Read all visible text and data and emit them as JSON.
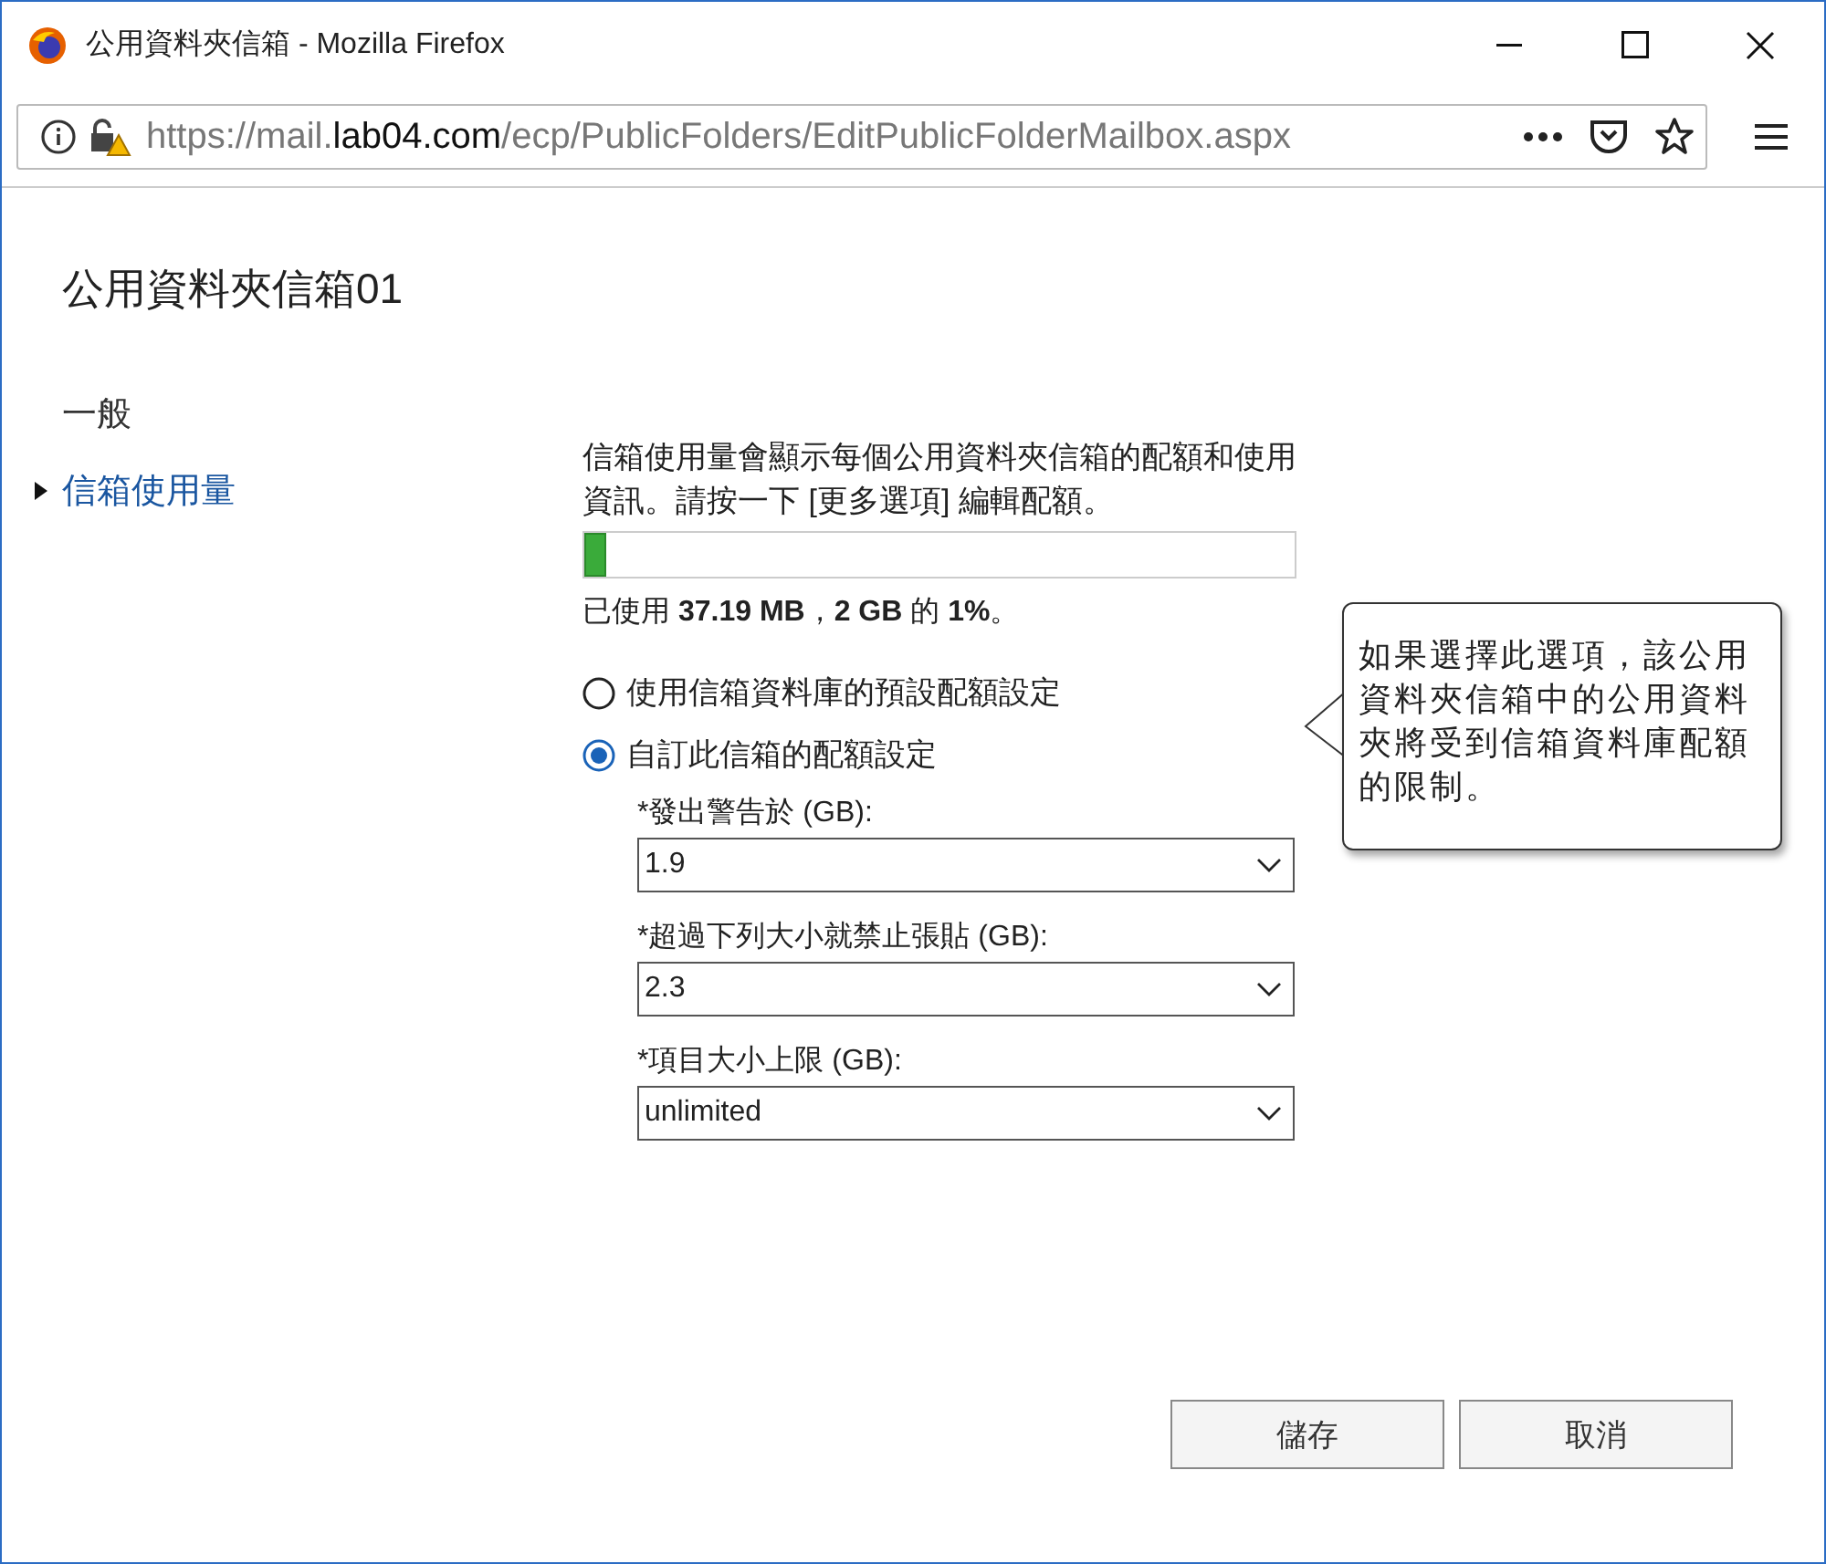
{
  "window": {
    "title": "公用資料夾信箱 - Mozilla Firefox"
  },
  "url": {
    "prefix": "https://mail.",
    "domain": "lab04.com",
    "path": "/ecp/PublicFolders/EditPublicFolderMailbox.aspx"
  },
  "heading": "公用資料夾信箱01",
  "nav": [
    {
      "label": "一般",
      "selected": false
    },
    {
      "label": "信箱使用量",
      "selected": true
    }
  ],
  "intro": "信箱使用量會顯示每個公用資料夾信箱的配額和使用資訊。請按一下 [更多選項] 編輯配額。",
  "usage": {
    "level": 0.03,
    "text": "已使用 **37.19 MB**，**2 GB** 的 **1%**。"
  },
  "options": [
    {
      "label": "使用信箱資料庫的預設配額設定",
      "selected": false
    },
    {
      "label": "自訂此信箱的配額設定",
      "selected": true
    }
  ],
  "quotas": [
    {
      "label": "*發出警告於 (GB):",
      "value": "1.9"
    },
    {
      "label": "*超過下列大小就禁止張貼 (GB):",
      "value": "2.3"
    },
    {
      "label": "*項目大小上限 (GB):",
      "value": "unlimited"
    }
  ],
  "tooltip": "如果選擇此選項，該公用資料夾信箱中的公用資料夾將受到信箱資料庫配額的限制。",
  "buttons": [
    "儲存",
    "取消"
  ]
}
